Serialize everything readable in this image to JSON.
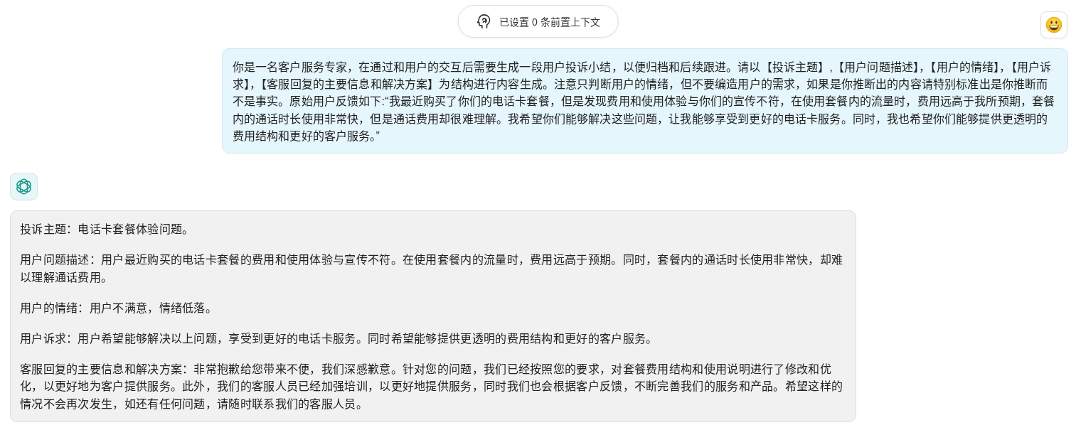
{
  "context_bar": {
    "label": "已设置 0 条前置上下文"
  },
  "messages": [
    {
      "kind": "user",
      "paragraphs": [
        "你是一名客户服务专家，在通过和用户的交互后需要生成一段用户投诉小结，以便归档和后续跟进。请以【投诉主题】,【用户问题描述】，【用户的情绪】，【用户诉求】，【客服回复的主要信息和解决方案】为结构进行内容生成。注意只判断用户的情绪，但不要编造用户的需求，如果是你推断出的内容请特别标准出是你推断而不是事实。原始用户反馈如下:“我最近购买了你们的电话卡套餐，但是发现费用和使用体验与你们的宣传不符，在使用套餐内的流量时，费用远高于我所预期，套餐内的通话时长使用非常快，但是通话费用却很难理解。我希望你们能够解决这些问题，让我能够享受到更好的电话卡服务。同时，我也希望你们能够提供更透明的费用结构和更好的客户服务。”"
      ]
    },
    {
      "kind": "assistant",
      "paragraphs": [
        "投诉主题：电话卡套餐体验问题。",
        "用户问题描述：用户最近购买的电话卡套餐的费用和使用体验与宣传不符。在使用套餐内的流量时，费用远高于预期。同时，套餐内的通话时长使用非常快，却难以理解通话费用。",
        "用户的情绪：用户不满意，情绪低落。",
        "用户诉求：用户希望能够解决以上问题，享受到更好的电话卡服务。同时希望能够提供更透明的费用结构和更好的客户服务。",
        "客服回复的主要信息和解决方案：非常抱歉给您带来不便，我们深感歉意。针对您的问题，我们已经按照您的要求，对套餐费用结构和使用说明进行了修改和优化，以更好地为客户提供服务。此外，我们的客服人员已经加强培训，以更好地提供服务，同时我们也会根据客户反馈，不断完善我们的服务和产品。希望这样的情况不会再次发生，如还有任何问题，请随时联系我们的客服人员。"
      ]
    }
  ]
}
